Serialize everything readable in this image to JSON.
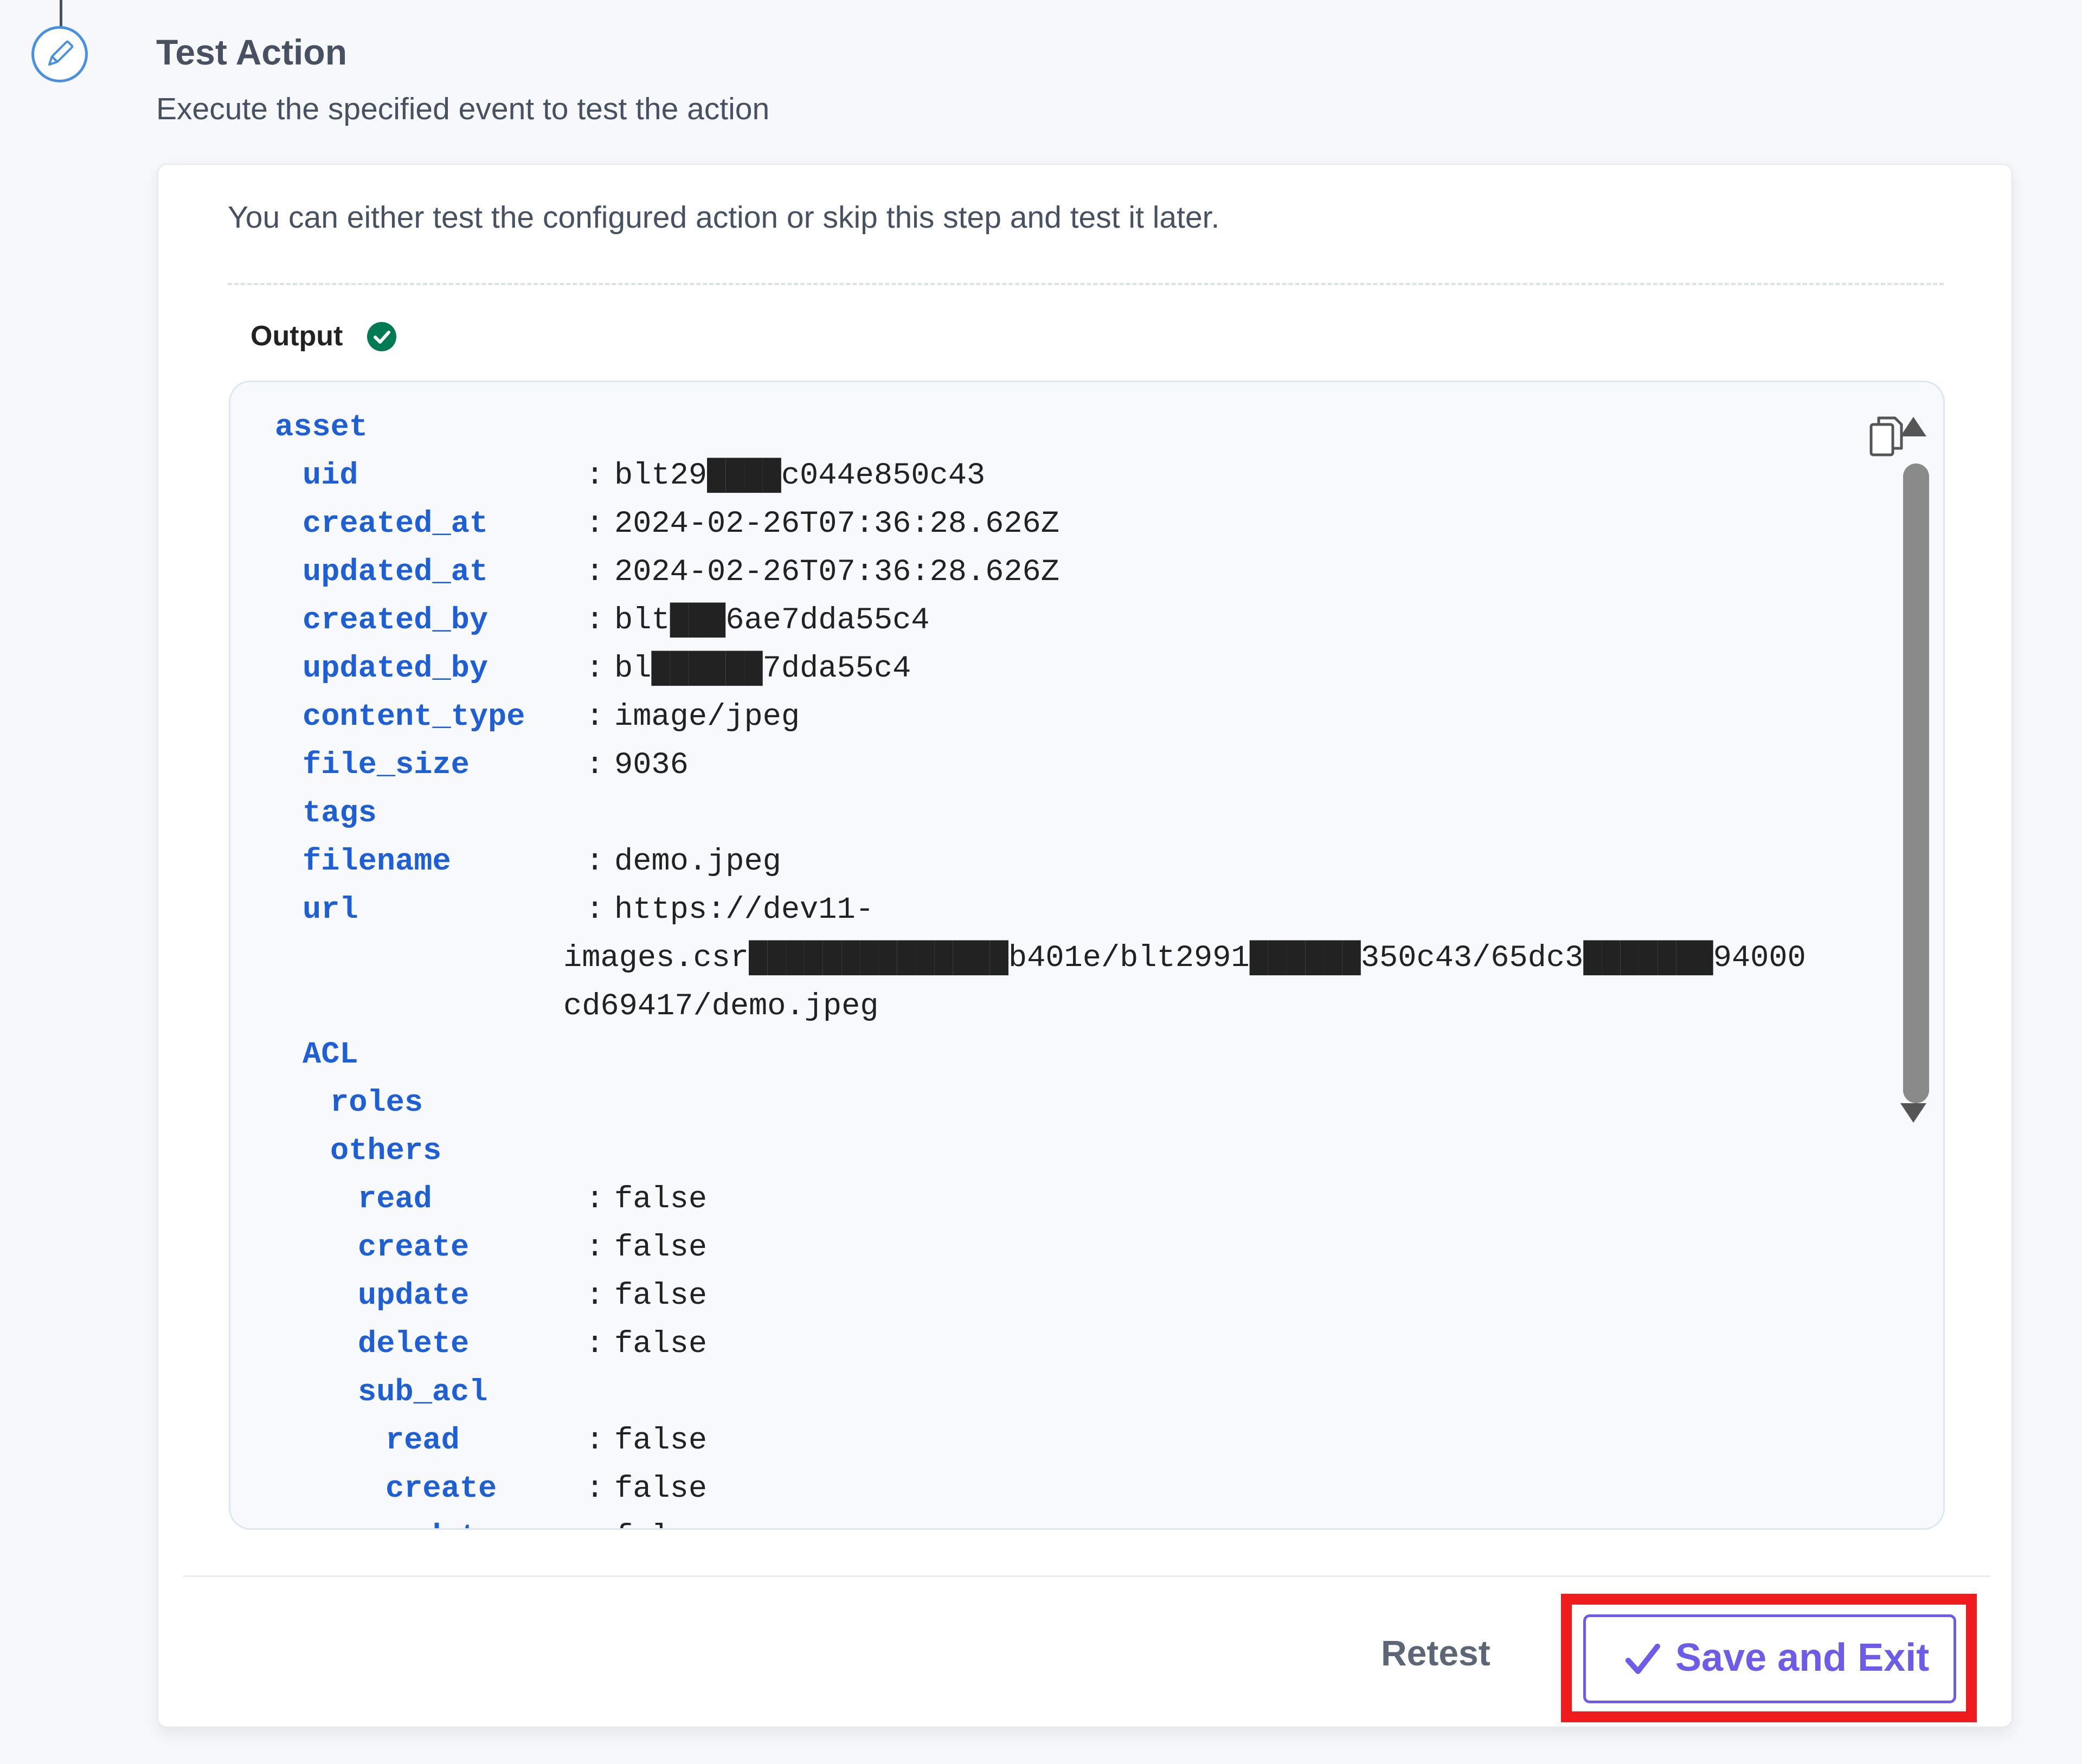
{
  "step": {
    "title": "Test Action",
    "subtitle": "Execute the specified event to test the action",
    "icon": "pencil-icon"
  },
  "card": {
    "intro": "You can either test the configured action or skip this step and test it later.",
    "output_label": "Output",
    "output_status_icon": "check-circle-icon"
  },
  "output": {
    "lines": [
      {
        "key": "asset",
        "indent": 0
      },
      {
        "key": "uid",
        "indent": 1,
        "value": "blt29████c044e850c43"
      },
      {
        "key": "created_at",
        "indent": 1,
        "value": "2024-02-26T07:36:28.626Z"
      },
      {
        "key": "updated_at",
        "indent": 1,
        "value": "2024-02-26T07:36:28.626Z"
      },
      {
        "key": "created_by",
        "indent": 1,
        "value": "blt███6ae7dda55c4"
      },
      {
        "key": "updated_by",
        "indent": 1,
        "value": "bl██████7dda55c4"
      },
      {
        "key": "content_type",
        "indent": 1,
        "value": "image/jpeg"
      },
      {
        "key": "file_size",
        "indent": 1,
        "value": "9036"
      },
      {
        "key": "tags",
        "indent": 1
      },
      {
        "key": "filename",
        "indent": 1,
        "value": "demo.jpeg"
      },
      {
        "key": "url",
        "indent": 1,
        "value": "https://dev11-"
      },
      {
        "cont": "images.csr██████████████b401e/blt2991██████350c43/65dc3███████94000"
      },
      {
        "cont": "cd69417/demo.jpeg"
      },
      {
        "key": "ACL",
        "indent": 1
      },
      {
        "key": "roles",
        "indent": 2
      },
      {
        "key": "others",
        "indent": 2
      },
      {
        "key": "read",
        "indent": 3,
        "value": "false"
      },
      {
        "key": "create",
        "indent": 3,
        "value": "false"
      },
      {
        "key": "update",
        "indent": 3,
        "value": "false"
      },
      {
        "key": "delete",
        "indent": 3,
        "value": "false"
      },
      {
        "key": "sub_acl",
        "indent": 3
      },
      {
        "key": "read",
        "indent": 4,
        "value": "false"
      },
      {
        "key": "create",
        "indent": 4,
        "value": "false"
      },
      {
        "key": "update",
        "indent": 4,
        "value": "false"
      }
    ]
  },
  "icons": {
    "copy": "copy-icon",
    "scroll_up": "scroll-up-arrow-icon",
    "scroll_down": "scroll-down-arrow-icon",
    "save_check": "checkmark-icon"
  },
  "actions": {
    "retest_label": "Retest",
    "save_exit_label": "Save and Exit"
  },
  "colors": {
    "key_blue": "#1f5fd6",
    "accent_purple": "#6c5ce7",
    "highlight_red": "#ee1c1c",
    "status_green": "#007a52"
  }
}
